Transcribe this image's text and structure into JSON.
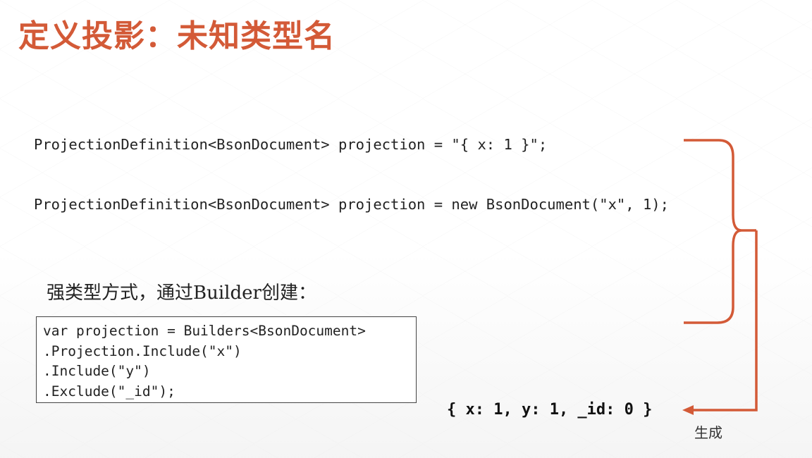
{
  "slide": {
    "title": "定义投影：未知类型名",
    "code_lines": [
      "ProjectionDefinition<BsonDocument> projection = \"{ x: 1 }\";",
      "ProjectionDefinition<BsonDocument> projection = new BsonDocument(\"x\", 1);"
    ],
    "subtitle": "强类型方式，通过Builder创建：",
    "builder_code": [
      "var projection = Builders<BsonDocument>",
      ".Projection.Include(\"x\")",
      ".Include(\"y\")",
      ".Exclude(\"_id\");"
    ],
    "result": "{ x: 1, y: 1, _id: 0 }",
    "result_label": "生成",
    "accent_color": "#d35a37",
    "icons": [
      "curly-bracket",
      "arrow-left"
    ]
  }
}
